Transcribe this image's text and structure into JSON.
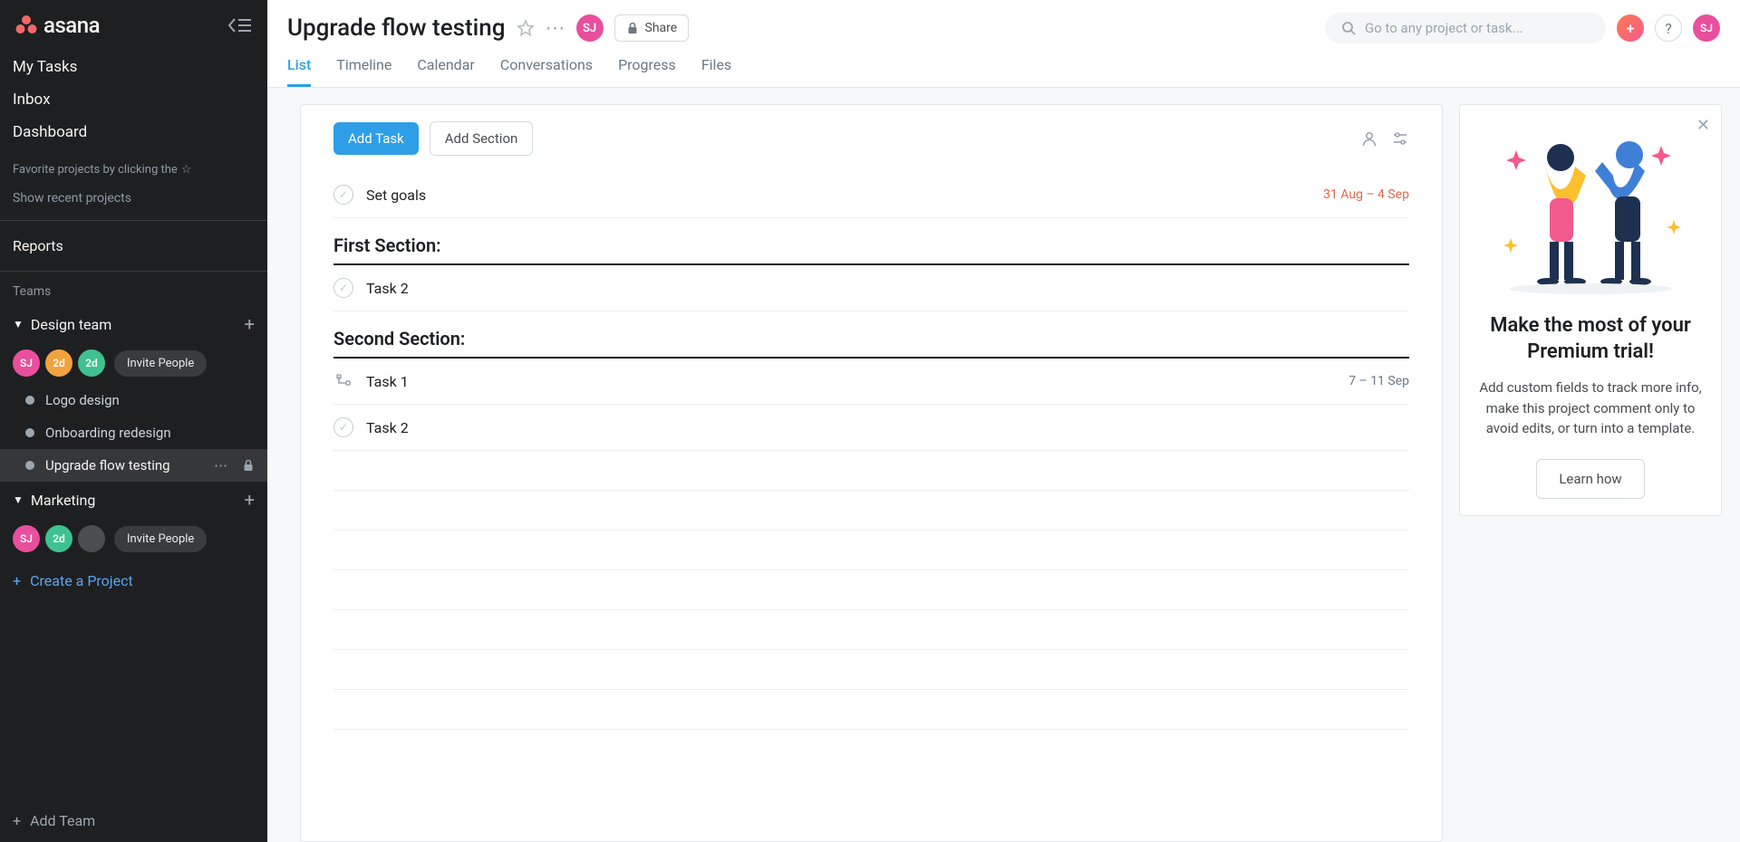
{
  "sidebar": {
    "nav": [
      "My Tasks",
      "Inbox",
      "Dashboard"
    ],
    "fav_hint": "Favorite projects by clicking the",
    "recent": "Show recent projects",
    "reports": "Reports",
    "teams_label": "Teams",
    "teams": [
      {
        "name": "Design team",
        "avatars": [
          {
            "label": "SJ",
            "cls": "sj"
          },
          {
            "label": "2d",
            "cls": "or"
          },
          {
            "label": "2d",
            "cls": "gr"
          }
        ],
        "invite": "Invite People",
        "projects": [
          {
            "name": "Logo design",
            "active": false
          },
          {
            "name": "Onboarding redesign",
            "active": false
          },
          {
            "name": "Upgrade flow testing",
            "active": true,
            "private": true
          }
        ]
      },
      {
        "name": "Marketing",
        "avatars": [
          {
            "label": "SJ",
            "cls": "sj"
          },
          {
            "label": "2d",
            "cls": "gr"
          },
          {
            "label": "",
            "cls": "dk"
          }
        ],
        "invite": "Invite People",
        "projects": []
      }
    ],
    "create_project": "Create a Project",
    "add_team": "Add Team"
  },
  "header": {
    "title": "Upgrade flow testing",
    "share": "Share",
    "search_placeholder": "Go to any project or task...",
    "user": "SJ"
  },
  "tabs": [
    "List",
    "Timeline",
    "Calendar",
    "Conversations",
    "Progress",
    "Files"
  ],
  "active_tab": "List",
  "toolbar": {
    "add_task": "Add Task",
    "add_section": "Add Section"
  },
  "tasks": [
    {
      "type": "task",
      "name": "Set goals",
      "date": "31 Aug – 4 Sep",
      "overdue": true,
      "icon": "check"
    },
    {
      "type": "section",
      "name": "First Section:"
    },
    {
      "type": "task",
      "name": "Task 2",
      "date": "",
      "icon": "check"
    },
    {
      "type": "section",
      "name": "Second Section:"
    },
    {
      "type": "task",
      "name": "Task 1",
      "date": "7 – 11 Sep",
      "icon": "subtask"
    },
    {
      "type": "task",
      "name": "Task 2",
      "date": "",
      "icon": "check"
    }
  ],
  "promo": {
    "title": "Make the most of your Premium trial!",
    "body": "Add custom fields to track more info, make this project comment only to avoid edits, or turn into a template.",
    "cta": "Learn how"
  }
}
